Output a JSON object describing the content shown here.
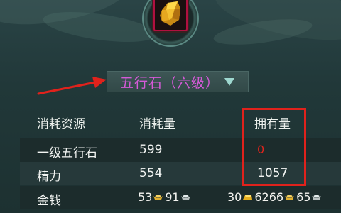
{
  "item": {
    "name": "gold-ore"
  },
  "selector": {
    "label": "五行石（六级）"
  },
  "table": {
    "headers": [
      "消耗资源",
      "消耗量",
      "拥有量"
    ],
    "rows": [
      {
        "resource": "一级五行石",
        "cost": "599",
        "owned": "0"
      },
      {
        "resource": "精力",
        "cost": "554",
        "owned": "1057"
      },
      {
        "resource": "金钱",
        "cost": {
          "gold": "53",
          "silver": "91"
        },
        "owned": {
          "a": "30",
          "b": "6266",
          "c": "65"
        }
      }
    ]
  },
  "colors": {
    "highlight": "#e0221c",
    "selector_text": "#d55ad8",
    "zero_value": "#e0241c"
  }
}
